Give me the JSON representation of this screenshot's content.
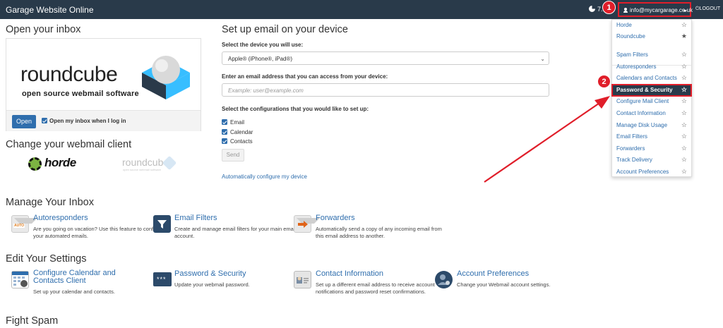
{
  "topbar": {
    "title": "Garage Website Online",
    "stats_text": "7.",
    "user_email": "info@mycargarage.co.uk",
    "logout_label": "LOGOUT"
  },
  "annotations": {
    "badge_one": "1",
    "badge_two": "2",
    "accent_color": "#e01e2a"
  },
  "inbox": {
    "heading": "Open your inbox",
    "logo_word": "roundcube",
    "logo_sub": "open source webmail software",
    "open_button": "Open",
    "open_checkbox_label": "Open my inbox when I log in"
  },
  "webmail_client": {
    "heading": "Change your webmail client",
    "horde_label": "horde",
    "roundcube_label": "roundcube",
    "roundcube_sub": "open source webmail software"
  },
  "device_setup": {
    "heading": "Set up email on your device",
    "device_label": "Select the device you will use:",
    "device_value": "Apple® (iPhone®, iPad®)",
    "email_label": "Enter an email address that you can access from your device:",
    "email_placeholder": "Example: user@example.com",
    "config_label": "Select the configurations that you would like to set up:",
    "configs": [
      "Email",
      "Calendar",
      "Contacts"
    ],
    "send_button": "Send",
    "auto_link": "Automatically configure my device"
  },
  "dropdown": {
    "items": [
      {
        "label": "Horde",
        "star": "☆"
      },
      {
        "label": "Roundcube",
        "star": "★"
      },
      {
        "label": "Spam Filters",
        "star": "☆"
      },
      {
        "label": "Autoresponders",
        "star": "☆"
      },
      {
        "label": "Calendars and Contacts",
        "star": "☆"
      },
      {
        "label": "Password & Security",
        "star": "☆"
      },
      {
        "label": "Configure Mail Client",
        "star": "☆"
      },
      {
        "label": "Contact Information",
        "star": "☆"
      },
      {
        "label": "Manage Disk Usage",
        "star": "☆"
      },
      {
        "label": "Email Filters",
        "star": "☆"
      },
      {
        "label": "Forwarders",
        "star": "☆"
      },
      {
        "label": "Track Delivery",
        "star": "☆"
      },
      {
        "label": "Account Preferences",
        "star": "☆"
      }
    ]
  },
  "manage_inbox": {
    "heading": "Manage Your Inbox",
    "items": [
      {
        "title": "Autoresponders",
        "desc": "Are you going on vacation? Use this feature to configure your automated emails.",
        "icon_text": "AUTO"
      },
      {
        "title": "Email Filters",
        "desc": "Create and manage email filters for your main email account."
      },
      {
        "title": "Forwarders",
        "desc": "Automatically send a copy of any incoming email from this email address to another."
      }
    ]
  },
  "edit_settings": {
    "heading": "Edit Your Settings",
    "items": [
      {
        "title": "Configure Calendar and Contacts Client",
        "desc": "Set up your calendar and contacts."
      },
      {
        "title": "Password & Security",
        "desc": "Update your webmail password.",
        "icon_text": "***"
      },
      {
        "title": "Contact Information",
        "desc": "Set up a different email address to receive account notifications and password reset confirmations."
      },
      {
        "title": "Account Preferences",
        "desc": "Change your Webmail account settings."
      }
    ]
  },
  "fight_spam": {
    "heading": "Fight Spam"
  }
}
